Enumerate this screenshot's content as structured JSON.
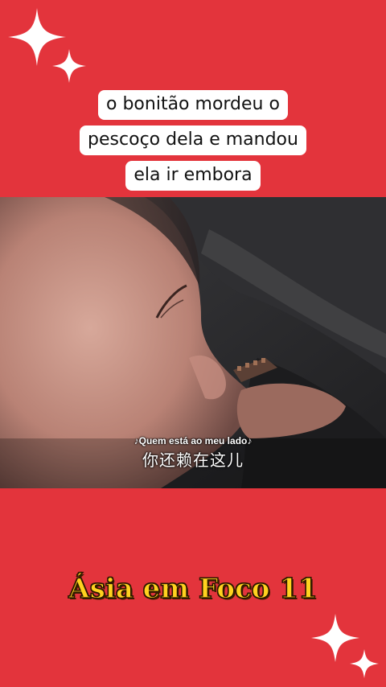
{
  "caption": {
    "lines": [
      "o bonitão mordeu o",
      "pescoço dela e mandou",
      "ela ir embora"
    ]
  },
  "video": {
    "subtitle_secondary": "♪Quem está ao meu lado♪",
    "subtitle_primary": "你还赖在这儿"
  },
  "brand": {
    "title": "Ásia em Foco 11"
  },
  "colors": {
    "background": "#e3343c",
    "caption_bg": "#ffffff",
    "brand_text": "#ffd21f"
  },
  "icons": [
    "sparkle-icon"
  ]
}
